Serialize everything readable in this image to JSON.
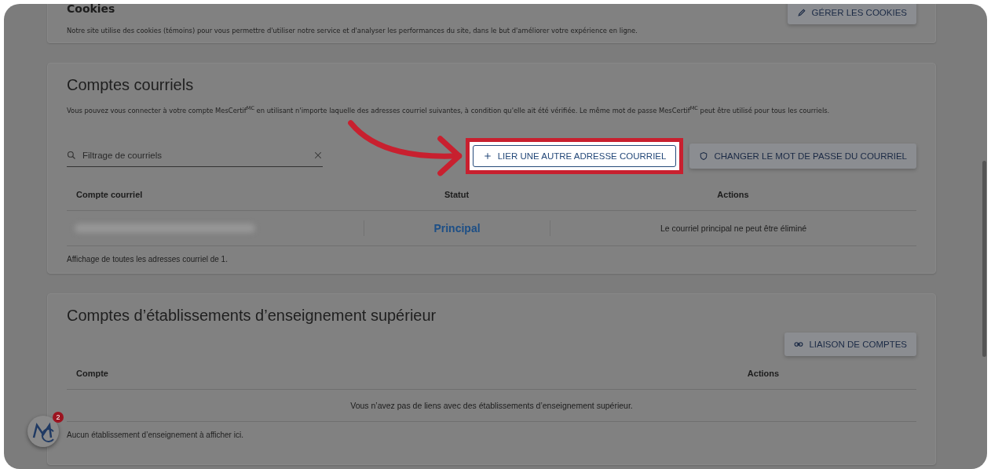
{
  "cookies": {
    "title": "Cookies",
    "description": "Notre site utilise des cookies (témoins) pour vous permettre d'utiliser notre service et d'analyser les performances du site, dans le but d'améliorer votre expérience en ligne.",
    "button": "GÉRER LES COOKIES"
  },
  "email_accounts": {
    "title": "Comptes courriels",
    "description": "Vous pouvez vous connecter à votre compte MesCertif$^{MC}$ en utilisant n'importe laquelle des adresses courriel suivantes, à condition qu'elle ait été vérifiée. Le même mot de passe MesCertif$^{MC}$ peut être utilisé pour tous les courriels.",
    "filter": {
      "placeholder": "Filtrage de courriels"
    },
    "buttons": [
      {
        "kind": "add",
        "label": "LIER UNE AUTRE ADRESSE COURRIEL",
        "highlighted": true
      },
      {
        "kind": "password",
        "label": "CHANGER LE MOT DE PASSE DU COURRIEL",
        "highlighted": false
      }
    ],
    "table": {
      "columns": [
        "Compte courriel",
        "Statut",
        "Actions"
      ],
      "rows": [
        {
          "status": "Principal",
          "actions": "Le courriel principal ne peut être éliminé"
        }
      ]
    },
    "footer": "Affichage de toutes les adresses courriel de 1."
  },
  "institution_accounts": {
    "title": "Comptes d’établissements d’enseignement supérieur",
    "button": "LIAISON DE COMPTES",
    "table": {
      "columns": [
        "Compte",
        "Actions"
      ],
      "empty_message": "Vous n’avez pas de liens avec des établissements d’enseignement supérieur."
    },
    "footer": "Aucun établissement d’enseignement à afficher ici."
  },
  "chat_badge": {
    "count": "2"
  }
}
